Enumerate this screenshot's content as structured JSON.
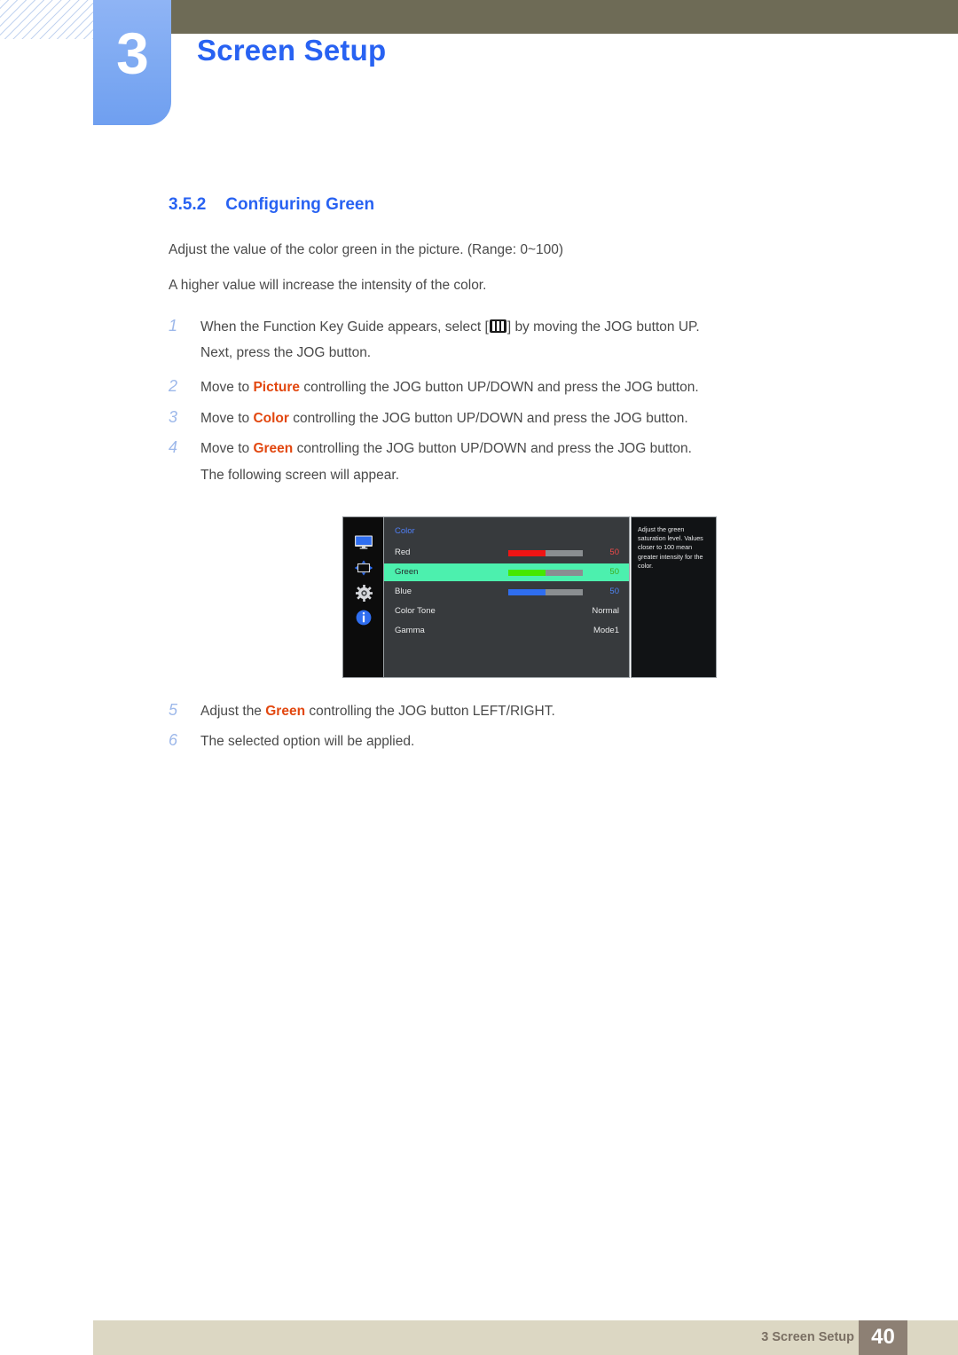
{
  "header": {
    "chapter_number": "3",
    "chapter_title": "Screen Setup",
    "accent_blue": "#2862f2",
    "olive": "#6e6b56"
  },
  "section": {
    "number": "3.5.2",
    "title": "Configuring Green"
  },
  "intro": {
    "line1": "Adjust the value of the color green in the picture. (Range: 0~100)",
    "line2": "A higher value will increase the intensity of the color."
  },
  "steps": [
    {
      "index": "1",
      "text_before": "When the Function Key Guide appears, select [",
      "icon": "menu-bars-icon",
      "text_after": "] by moving the JOG button UP.",
      "continuation": "Next, press the JOG button."
    },
    {
      "index": "2",
      "text_before": "Move to ",
      "highlight": "Picture",
      "text_after": " controlling the JOG button UP/DOWN and press the JOG button."
    },
    {
      "index": "3",
      "text_before": "Move to ",
      "highlight": "Color",
      "text_after": " controlling the JOG button UP/DOWN and press the JOG button."
    },
    {
      "index": "4",
      "text_before": "Move to ",
      "highlight": "Green",
      "text_after": " controlling the JOG button UP/DOWN and press the JOG button.",
      "continuation": "The following screen will appear."
    },
    {
      "index": "5",
      "text_before": "Adjust the ",
      "highlight": "Green",
      "text_after": " controlling the JOG button LEFT/RIGHT."
    },
    {
      "index": "6",
      "text_before": "The selected option will be applied."
    }
  ],
  "osd": {
    "menu_title": "Color",
    "rail_icons": [
      {
        "name": "picture-monitor-icon"
      },
      {
        "name": "picture-position-icon"
      },
      {
        "name": "system-gear-icon"
      },
      {
        "name": "information-icon"
      }
    ],
    "rows": [
      {
        "label": "Red",
        "value": "50",
        "type": "slider",
        "fill": 50,
        "color": "#f01414",
        "value_color": "#f04a4a"
      },
      {
        "label": "Green",
        "value": "50",
        "type": "slider",
        "fill": 50,
        "color": "#45e800",
        "value_color": "#3faa1e",
        "selected": true
      },
      {
        "label": "Blue",
        "value": "50",
        "type": "slider",
        "fill": 50,
        "color": "#2f6ef0",
        "value_color": "#4d84f2"
      },
      {
        "label": "Color Tone",
        "value": "Normal",
        "type": "text",
        "value_color": "#e6e7e8"
      },
      {
        "label": "Gamma",
        "value": "Mode1",
        "type": "text",
        "value_color": "#e6e7e8"
      }
    ],
    "help_text": "Adjust the green saturation level. Values closer to 100 mean greater intensity for the color.",
    "highlight_color": "#4cf0ae"
  },
  "footer": {
    "label": "3 Screen Setup",
    "page_number": "40"
  }
}
